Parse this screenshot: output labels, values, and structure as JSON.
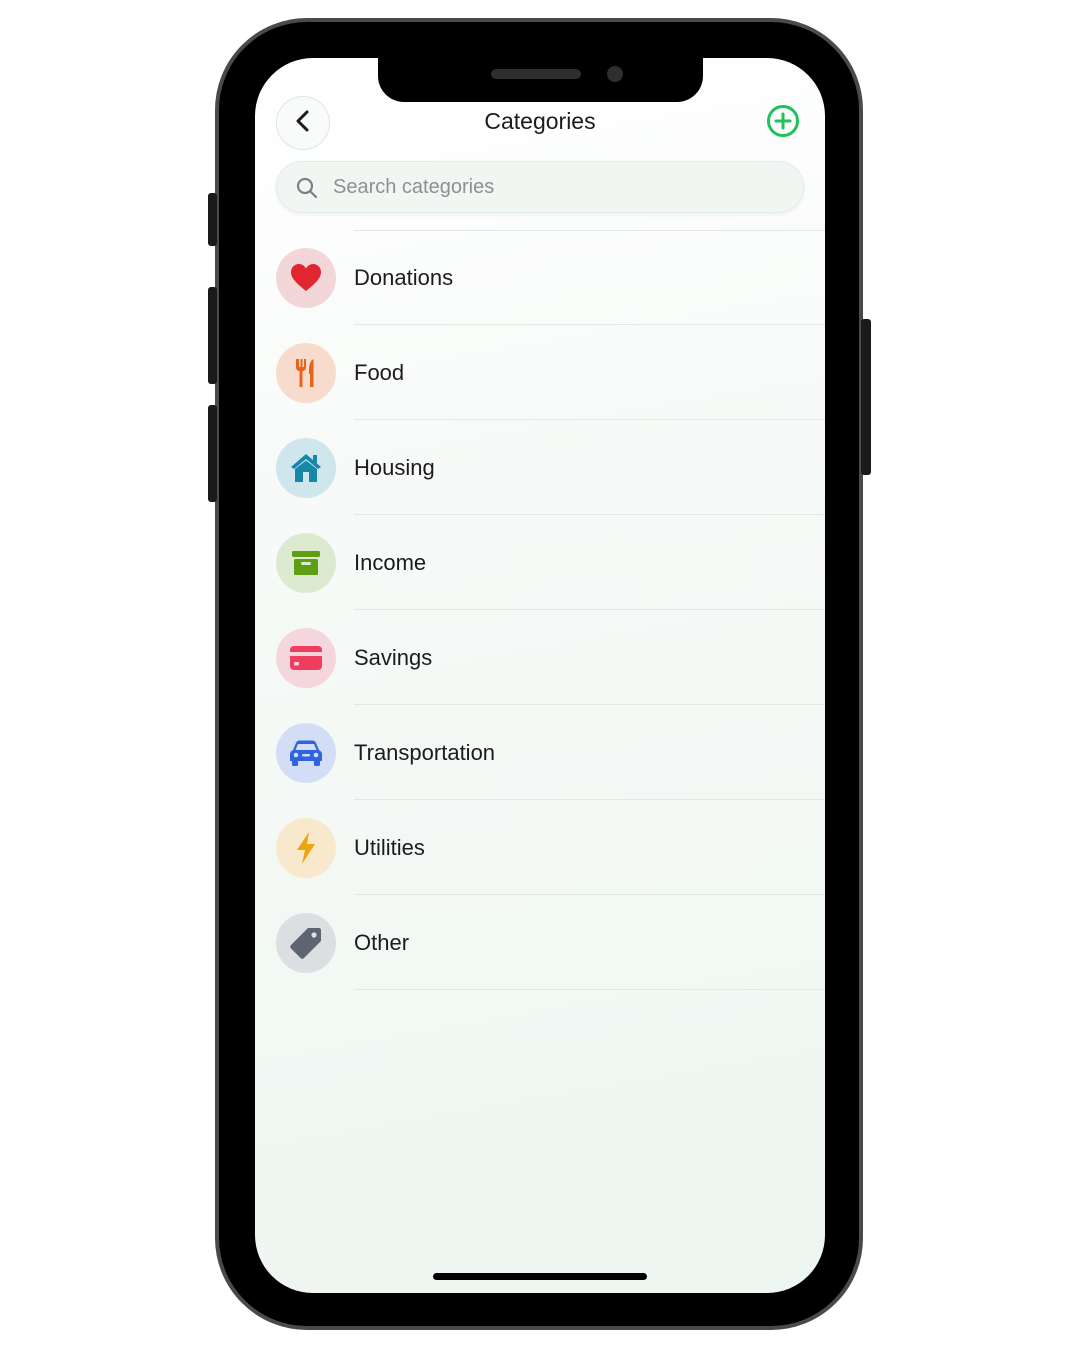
{
  "header": {
    "title": "Categories",
    "back_icon": "chevron-left-icon",
    "add_icon": "plus-circle-icon",
    "accent_color": "#22c05a"
  },
  "search": {
    "placeholder": "Search categories",
    "icon": "search-icon"
  },
  "categories": [
    {
      "label": "Donations",
      "icon": "heart-icon",
      "icon_color": "#e0262f",
      "bg_color": "#f3d6d8"
    },
    {
      "label": "Food",
      "icon": "fork-knife-icon",
      "icon_color": "#e8641a",
      "bg_color": "#f7dccd"
    },
    {
      "label": "Housing",
      "icon": "house-icon",
      "icon_color": "#1687a8",
      "bg_color": "#cfe6ec"
    },
    {
      "label": "Income",
      "icon": "archive-box-icon",
      "icon_color": "#5e9e12",
      "bg_color": "#dcebcf"
    },
    {
      "label": "Savings",
      "icon": "credit-card-icon",
      "icon_color": "#ee3d5f",
      "bg_color": "#f5d6dc"
    },
    {
      "label": "Transportation",
      "icon": "car-icon",
      "icon_color": "#2f63e0",
      "bg_color": "#d3def6"
    },
    {
      "label": "Utilities",
      "icon": "lightning-bolt-icon",
      "icon_color": "#f0a310",
      "bg_color": "#f8e9cc"
    },
    {
      "label": "Other",
      "icon": "tag-icon",
      "icon_color": "#5d6670",
      "bg_color": "#dcdfe1"
    }
  ]
}
